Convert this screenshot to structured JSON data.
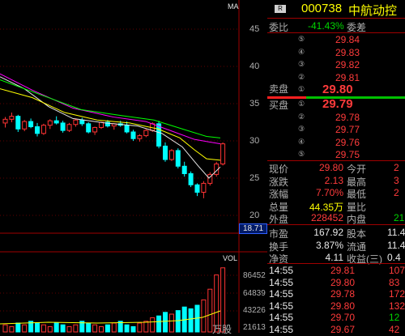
{
  "chart": {
    "ma_label": "MA",
    "price_ticks": [
      "45",
      "40",
      "35",
      "30",
      "25",
      "20"
    ],
    "current_price_tag": "18.71",
    "vol_label": "VOL",
    "vol_ticks": [
      "86452",
      "64839",
      "43226",
      "21613"
    ],
    "vol_unit": "万股",
    "colors": {
      "up": "#ff3333",
      "down": "#00ffff",
      "ma5": "#e8e8e8",
      "ma10": "#ffff00",
      "ma20": "#ff00ff",
      "ma60": "#00ff00"
    }
  },
  "quote": {
    "badge": "R",
    "code": "000738",
    "name": "中航动控",
    "weibi_label": "委比",
    "weibi_value": "-41.43%",
    "weicha_label": "委差",
    "sell_label": "卖盘",
    "buy_label": "买盘",
    "sell_levels": [
      {
        "idx": "⑤",
        "price": "29.84"
      },
      {
        "idx": "④",
        "price": "29.83"
      },
      {
        "idx": "③",
        "price": "29.82"
      },
      {
        "idx": "②",
        "price": "29.81"
      },
      {
        "idx": "①",
        "price": "29.80"
      }
    ],
    "buy_levels": [
      {
        "idx": "①",
        "price": "29.79"
      },
      {
        "idx": "②",
        "price": "29.78"
      },
      {
        "idx": "③",
        "price": "29.77"
      },
      {
        "idx": "④",
        "price": "29.76"
      },
      {
        "idx": "⑤",
        "price": "29.75"
      }
    ],
    "stats": [
      {
        "l1": "现价",
        "v1": "29.80",
        "l2": "今开",
        "v2": "2"
      },
      {
        "l1": "涨跌",
        "v1": "2.13",
        "l2": "最高",
        "v2": "3"
      },
      {
        "l1": "涨幅",
        "v1": "7.70%",
        "l2": "最低",
        "v2": "2"
      },
      {
        "l1": "总量",
        "v1": "44.35万",
        "l2": "量比",
        "v2": ""
      },
      {
        "l1": "外盘",
        "v1": "228452",
        "l2": "内盘",
        "v2": "21"
      }
    ],
    "fin": [
      {
        "l1": "市盈",
        "v1": "167.92",
        "l2": "股本",
        "v2": "11.4"
      },
      {
        "l1": "换手",
        "v1": "3.87%",
        "l2": "流通",
        "v2": "11.4"
      },
      {
        "l1": "净资",
        "v1": "4.11",
        "l2": "收益(三)",
        "v2": "0.4"
      }
    ],
    "ticks": [
      {
        "time": "14:55",
        "price": "29.81",
        "vol": "107"
      },
      {
        "time": "14:55",
        "price": "29.80",
        "vol": "83"
      },
      {
        "time": "14:55",
        "price": "29.78",
        "vol": "172"
      },
      {
        "time": "14:55",
        "price": "29.80",
        "vol": "132"
      },
      {
        "time": "14:55",
        "price": "29.70",
        "vol": "12"
      },
      {
        "time": "14:55",
        "price": "29.67",
        "vol": "42"
      }
    ]
  }
}
